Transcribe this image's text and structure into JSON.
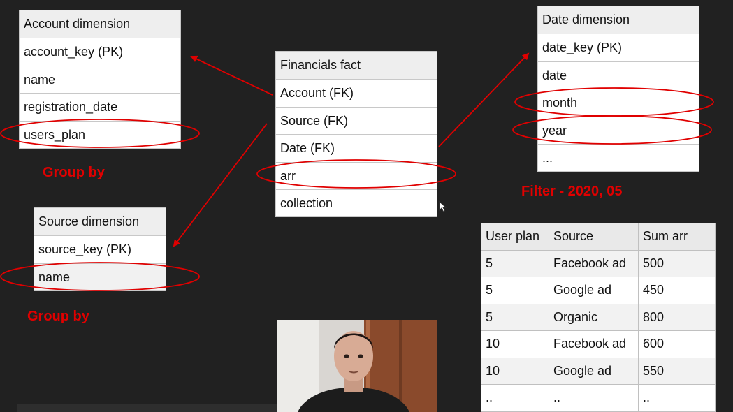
{
  "account_dimension": {
    "title": "Account dimension",
    "fields": [
      "account_key (PK)",
      "name",
      "registration_date",
      "users_plan"
    ]
  },
  "source_dimension": {
    "title": "Source dimension",
    "fields": [
      "source_key (PK)",
      "name"
    ]
  },
  "financials_fact": {
    "title": "Financials fact",
    "fields": [
      "Account (FK)",
      "Source (FK)",
      "Date (FK)",
      "arr",
      "collection"
    ]
  },
  "date_dimension": {
    "title": "Date dimension",
    "fields": [
      "date_key (PK)",
      "date",
      "month",
      "year",
      "..."
    ]
  },
  "annotations": {
    "group_by_account": "Group by",
    "group_by_source": "Group by",
    "filter": "Filter - 2020, 05"
  },
  "result_table": {
    "headers": [
      "User plan",
      "Source",
      "Sum arr"
    ],
    "rows": [
      [
        "5",
        "Facebook ad",
        "500"
      ],
      [
        "5",
        "Google ad",
        "450"
      ],
      [
        "5",
        "Organic",
        "800"
      ],
      [
        "10",
        "Facebook ad",
        "600"
      ],
      [
        "10",
        "Google ad",
        "550"
      ],
      [
        "..",
        "..",
        ".."
      ]
    ]
  },
  "colors": {
    "background": "#212121",
    "highlight_red": "#e00000",
    "table_header": "#eeeeee"
  }
}
